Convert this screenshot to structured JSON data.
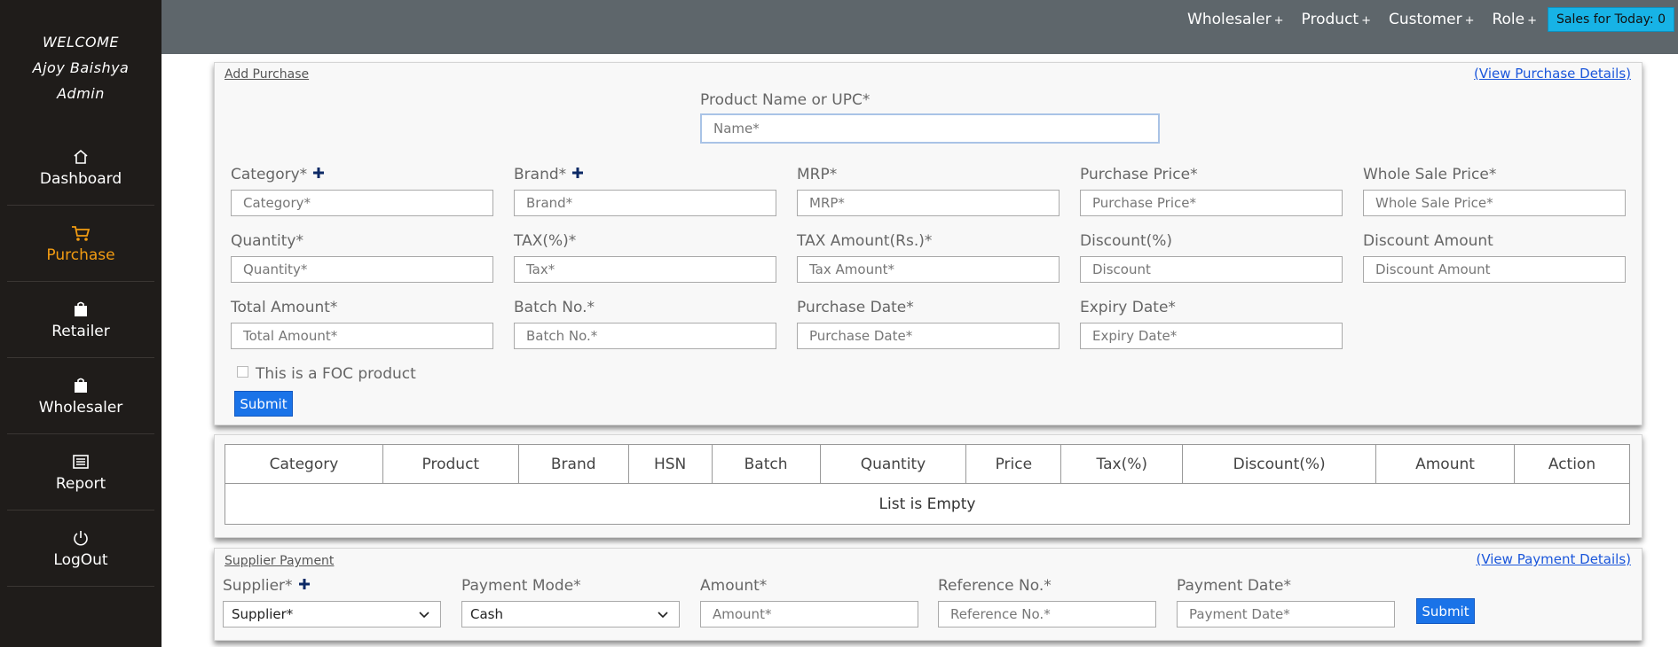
{
  "sidebar": {
    "welcome": "WELCOME",
    "user_name": "Ajoy Baishya",
    "role": "Admin",
    "items": [
      {
        "label": "Dashboard",
        "icon": "home-icon"
      },
      {
        "label": "Purchase",
        "icon": "cart-icon",
        "active": true
      },
      {
        "label": "Retailer",
        "icon": "bag-icon"
      },
      {
        "label": "Wholesaler",
        "icon": "bag-icon"
      },
      {
        "label": "Report",
        "icon": "report-icon"
      },
      {
        "label": "LogOut",
        "icon": "power-icon"
      }
    ],
    "active_color": "#f39c12"
  },
  "topbar": {
    "menus": [
      "Wholesaler",
      "Product",
      "Customer",
      "Role"
    ],
    "plus": "+",
    "sales_badge": "Sales for Today: 0"
  },
  "purchase_form": {
    "title": "Add Purchase",
    "view_link": "(View Purchase Details)",
    "product": {
      "label": "Product Name or UPC*",
      "placeholder": "Name*"
    },
    "fields": [
      {
        "label": "Category*",
        "placeholder": "Category*",
        "has_add": true
      },
      {
        "label": "Brand*",
        "placeholder": "Brand*",
        "has_add": true
      },
      {
        "label": "MRP*",
        "placeholder": "MRP*"
      },
      {
        "label": "Purchase Price*",
        "placeholder": "Purchase Price*"
      },
      {
        "label": "Whole Sale Price*",
        "placeholder": "Whole Sale Price*"
      },
      {
        "label": "Quantity*",
        "placeholder": "Quantity*"
      },
      {
        "label": "TAX(%)*",
        "placeholder": "Tax*"
      },
      {
        "label": "TAX Amount(Rs.)*",
        "placeholder": "Tax Amount*"
      },
      {
        "label": "Discount(%)",
        "placeholder": "Discount"
      },
      {
        "label": "Discount Amount",
        "placeholder": "Discount Amount"
      },
      {
        "label": "Total Amount*",
        "placeholder": "Total Amount*"
      },
      {
        "label": "Batch No.*",
        "placeholder": "Batch No.*"
      },
      {
        "label": "Purchase Date*",
        "placeholder": "Purchase Date*"
      },
      {
        "label": "Expiry Date*",
        "placeholder": "Expiry Date*"
      }
    ],
    "foc_label": "This is a FOC product",
    "submit": "Submit"
  },
  "purchase_table": {
    "columns": [
      "Category",
      "Product",
      "Brand",
      "HSN",
      "Batch",
      "Quantity",
      "Price",
      "Tax(%)",
      "Discount(%)",
      "Amount",
      "Action"
    ],
    "empty_text": "List is Empty"
  },
  "supplier_payment": {
    "title": "Supplier Payment",
    "view_link": "(View Payment Details)",
    "supplier": {
      "label": "Supplier*",
      "value": "Supplier*"
    },
    "payment_mode": {
      "label": "Payment Mode*",
      "value": "Cash"
    },
    "amount": {
      "label": "Amount*",
      "placeholder": "Amount*"
    },
    "reference": {
      "label": "Reference No.*",
      "placeholder": "Reference No.*"
    },
    "payment_date": {
      "label": "Payment Date*",
      "placeholder": "Payment Date*"
    },
    "submit": "Submit"
  },
  "colors": {
    "accent": "#1a73e8",
    "badge": "#17b3e6",
    "sidebar_bg": "#1f1c1a",
    "topbar_bg": "#5e666b"
  }
}
